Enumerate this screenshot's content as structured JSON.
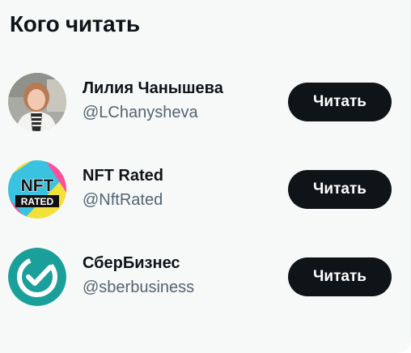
{
  "widget": {
    "title": "Кого читать"
  },
  "accounts": [
    {
      "name": "Лилия Чанышева",
      "handle": "@LChanysheva",
      "follow_label": "Читать",
      "avatar_icon": "person-photo-avatar"
    },
    {
      "name": "NFT Rated",
      "handle": "@NftRated",
      "follow_label": "Читать",
      "avatar_icon": "nft-rated-logo",
      "avatar_text": [
        "NFT",
        "RATED"
      ]
    },
    {
      "name": "СберБизнес",
      "handle": "@sberbusiness",
      "follow_label": "Читать",
      "avatar_icon": "sber-check-logo"
    }
  ],
  "colors": {
    "panel_bg": "#f7f9f9",
    "text_primary": "#0f1419",
    "text_secondary": "#536471",
    "button_bg": "#0f1419",
    "button_text": "#ffffff",
    "sber_green": "#1a9f9a"
  }
}
